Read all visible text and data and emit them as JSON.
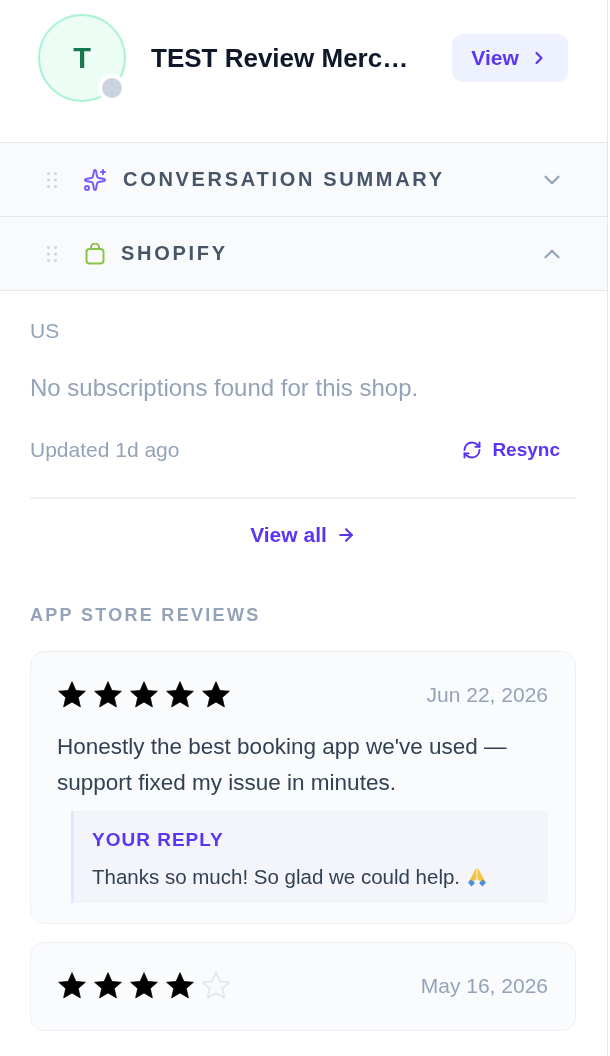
{
  "header": {
    "avatar_initial": "T",
    "online": false,
    "title": "TEST Review Merc…",
    "view_button": "View"
  },
  "sections": [
    {
      "kind": "summary",
      "title": "CONVERSATION SUMMARY",
      "expanded": false
    },
    {
      "kind": "shopify",
      "title": "SHOPIFY",
      "expanded": true,
      "content": {
        "country": "US",
        "message": "No subscriptions found for this shop.",
        "updated": "Updated 1d ago",
        "resync": "Resync",
        "view_all": "View all"
      }
    }
  ],
  "reviews": {
    "heading": "APP STORE REVIEWS",
    "items": [
      {
        "stars": 5,
        "date": "Jun 22, 2026",
        "text": "Honestly the best booking app we've used — support fixed my issue in minutes.",
        "reply": {
          "label": "YOUR REPLY",
          "text": "Thanks so much! So glad we could help."
        }
      },
      {
        "stars": 4,
        "date": "May 16, 2026"
      }
    ]
  }
}
